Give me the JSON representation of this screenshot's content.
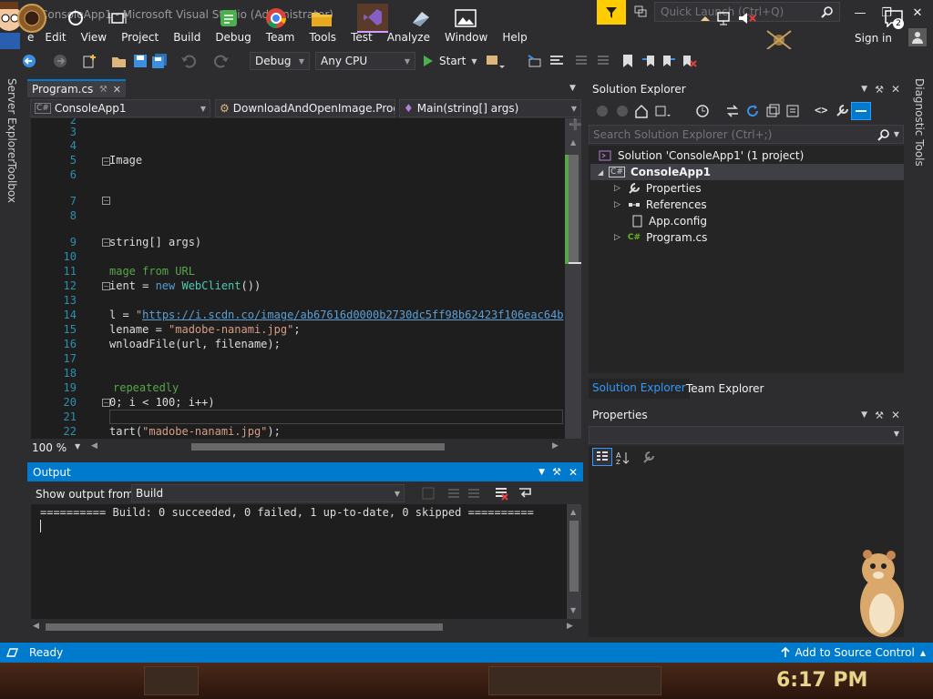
{
  "window": {
    "title": "ConsoleApp1 - Microsoft Visual Studio  (Administrator)",
    "quick_launch_placeholder": "Quick Launch (Ctrl+Q)"
  },
  "menu": [
    "File",
    "Edit",
    "View",
    "Project",
    "Build",
    "Debug",
    "Team",
    "Tools",
    "Test",
    "Analyze",
    "Window",
    "Help"
  ],
  "menu_first_visible": "e",
  "signin": "Sign in",
  "toolbar": {
    "config": "Debug",
    "platform": "Any CPU",
    "start": "Start"
  },
  "left_tabs": {
    "server_explorer": "Server Explorer",
    "toolbox": "Toolbox"
  },
  "right_tabs": {
    "diagnostic": "Diagnostic Tools"
  },
  "doc_tab": {
    "label": "Program.cs"
  },
  "nav": {
    "project": "ConsoleApp1",
    "type": "DownloadAndOpenImage.Prog",
    "member": "Main(string[] args)"
  },
  "editor": {
    "zoom": "100 %",
    "lines": [
      {
        "n": "2"
      },
      {
        "n": "3"
      },
      {
        "n": "4"
      },
      {
        "n": "5",
        "t": "Image"
      },
      {
        "n": "6"
      },
      {
        "n": "7"
      },
      {
        "n": "8"
      },
      {
        "n": "9",
        "t": "string[] args)"
      },
      {
        "n": "10"
      },
      {
        "n": "11",
        "c": "mage from URL"
      },
      {
        "n": "12",
        "pre": "ient = ",
        "kw": "new ",
        "ty": "WebClient",
        "post": "())"
      },
      {
        "n": "13"
      },
      {
        "n": "14",
        "pre": "l = ",
        "url": "https://i.scdn.co/image/ab67616d0000b2730dc5ff98b62423f106eac64b",
        "post": "\";"
      },
      {
        "n": "15",
        "pre": "lename = ",
        "st": "\"madobe-nanami.jpg\"",
        "post": ";"
      },
      {
        "n": "16",
        "t": "wnloadFile(url, filename);"
      },
      {
        "n": "17"
      },
      {
        "n": "18"
      },
      {
        "n": "19",
        "c": "repeatedly"
      },
      {
        "n": "20",
        "t": "0; i < 100; i++)"
      },
      {
        "n": "21"
      },
      {
        "n": "22",
        "pre": "tart(",
        "st": "\"madobe-nanami.jpg\"",
        "post": ");"
      }
    ]
  },
  "output": {
    "title": "Output",
    "show_from_label": "Show output from:",
    "source": "Build",
    "text": "========== Build: 0 succeeded, 0 failed, 1 up-to-date, 0 skipped =========="
  },
  "solution_explorer": {
    "title": "Solution Explorer",
    "search_placeholder": "Search Solution Explorer (Ctrl+;)",
    "items": [
      {
        "label": "Solution 'ConsoleApp1' (1 project)"
      },
      {
        "label": "ConsoleApp1"
      },
      {
        "label": "Properties"
      },
      {
        "label": "References"
      },
      {
        "label": "App.config"
      },
      {
        "label": "Program.cs"
      }
    ],
    "tabs": [
      "Solution Explorer",
      "Team Explorer"
    ]
  },
  "properties": {
    "title": "Properties"
  },
  "status": {
    "text": "Ready",
    "source_control": "Add to Source Control"
  },
  "taskbar": {
    "time": "6:17 PM",
    "notifications": "2"
  },
  "colors": {
    "accent": "#007acc",
    "background": "#2d2d30",
    "editor_bg": "#1e1e1e",
    "comment": "#57a64a",
    "keyword": "#569cd6",
    "type": "#4ec9b0",
    "string": "#d69d85"
  }
}
